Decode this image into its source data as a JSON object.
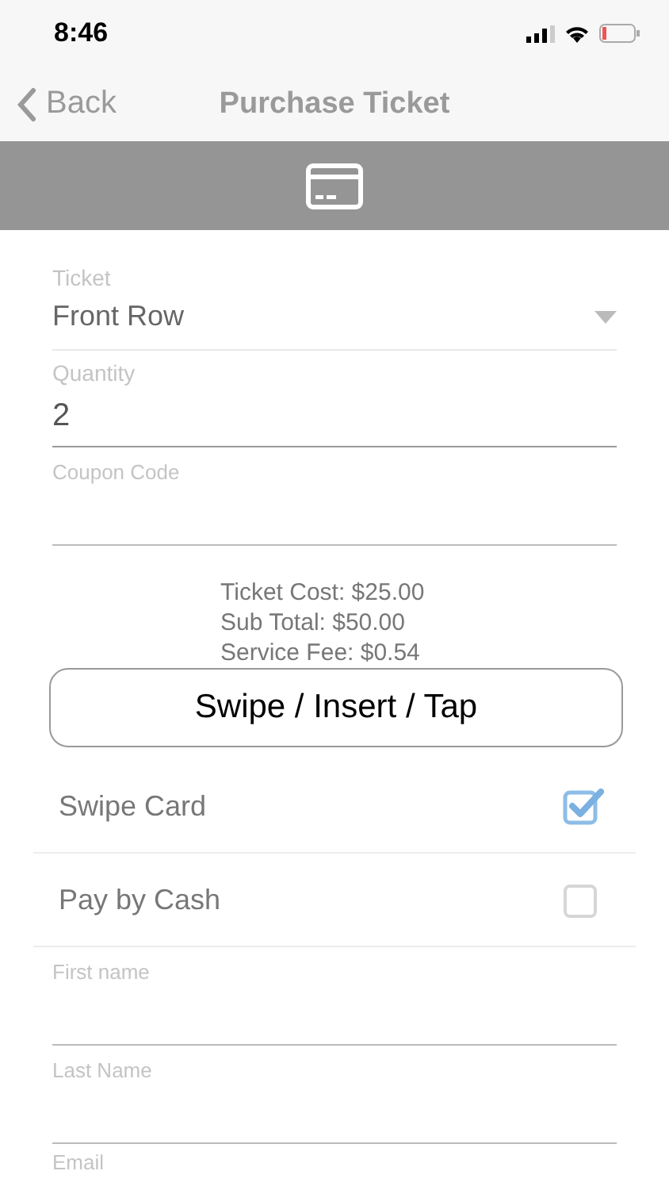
{
  "status_bar": {
    "time": "8:46"
  },
  "nav": {
    "back": "Back",
    "title": "Purchase Ticket"
  },
  "form": {
    "ticket": {
      "label": "Ticket",
      "value": "Front Row"
    },
    "quantity": {
      "label": "Quantity",
      "value": "2"
    },
    "coupon": {
      "placeholder": "Coupon Code"
    }
  },
  "summary": [
    "Ticket Cost: $25.00",
    "Sub Total: $50.00",
    "Service Fee: $0.54"
  ],
  "swipe_button": "Swipe / Insert / Tap",
  "payment_options": [
    {
      "label": "Swipe Card",
      "checked": true
    },
    {
      "label": "Pay by Cash",
      "checked": false
    }
  ],
  "contact_fields": [
    {
      "placeholder": "First name"
    },
    {
      "placeholder": "Last Name"
    },
    {
      "placeholder": "Email"
    }
  ]
}
